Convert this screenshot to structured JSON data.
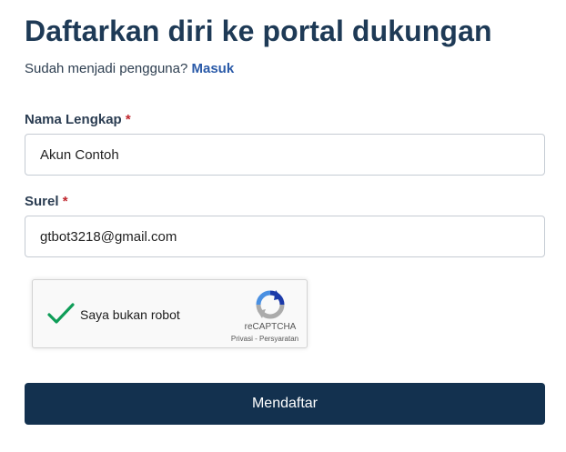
{
  "page": {
    "title": "Daftarkan diri ke portal dukungan",
    "subtitle_text": "Sudah menjadi pengguna? ",
    "signin_link": "Masuk"
  },
  "form": {
    "name": {
      "label": "Nama Lengkap",
      "required_mark": "*",
      "value": "Akun Contoh"
    },
    "email": {
      "label": "Surel",
      "required_mark": "*",
      "value": "gtbot3218@gmail.com"
    },
    "captcha": {
      "checked": true,
      "label": "Saya bukan robot",
      "brand": "reCAPTCHA",
      "privacy_link": "Privasi",
      "separator": " - ",
      "terms_link": "Persyaratan"
    },
    "submit_label": "Mendaftar"
  },
  "colors": {
    "title": "#1e3a56",
    "link": "#2a5aa8",
    "required": "#c0262d",
    "button": "#13314f",
    "check": "#0f9d58"
  },
  "icons": {
    "captcha_check": "checkmark-icon",
    "captcha_logo": "recaptcha-logo-icon"
  }
}
